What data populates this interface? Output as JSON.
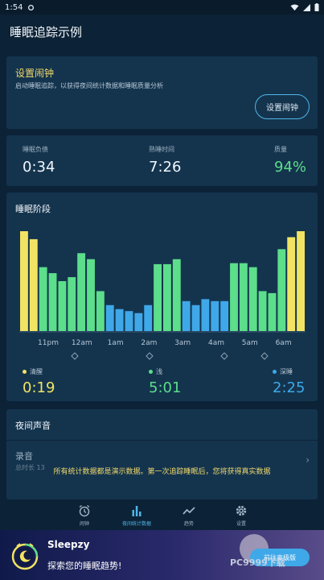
{
  "status_bar": {
    "time": "1:54"
  },
  "app_bar": {
    "title": "睡眠追踪示例"
  },
  "alarm_card": {
    "title": "设置闹钟",
    "description": "启动睡眠追踪，以获得夜间统计数据和睡眠质量分析",
    "button_label": "设置闹钟"
  },
  "stats": [
    {
      "label": "睡眠负债",
      "value": "0:34"
    },
    {
      "label": "熟睡时间",
      "value": "7:26"
    },
    {
      "label": "质量",
      "value": "94%"
    }
  ],
  "stages_card": {
    "title": "睡眠阶段"
  },
  "chart_data": {
    "type": "bar",
    "x_ticks": [
      "11pm",
      "12am",
      "1am",
      "2am",
      "3am",
      "4am",
      "5am",
      "6am"
    ],
    "values": [
      100,
      92,
      64,
      58,
      50,
      54,
      78,
      72,
      40,
      26,
      22,
      20,
      18,
      26,
      67,
      67,
      72,
      30,
      26,
      32,
      30,
      30,
      68,
      68,
      64,
      40,
      38,
      82,
      94,
      100
    ],
    "stages": [
      "awake",
      "awake",
      "light",
      "light",
      "light",
      "light",
      "light",
      "light",
      "light",
      "deep",
      "deep",
      "deep",
      "deep",
      "deep",
      "light",
      "light",
      "light",
      "deep",
      "deep",
      "deep",
      "deep",
      "deep",
      "light",
      "light",
      "light",
      "light",
      "light",
      "light",
      "awake",
      "awake"
    ],
    "ylim": [
      0,
      100
    ],
    "colors": {
      "awake": "#f2e462",
      "light": "#5cde8a",
      "deep": "#3fa8e8"
    }
  },
  "legend": [
    {
      "label": "清醒",
      "value": "0:19",
      "color": "#f2e462"
    },
    {
      "label": "浅",
      "value": "5:01",
      "color": "#5cde8a"
    },
    {
      "label": "深睡",
      "value": "2:25",
      "color": "#3fa8e8"
    }
  ],
  "sound_card": {
    "title": "夜间声音",
    "recording_label": "录音",
    "recording_sub": "总时长 13"
  },
  "notice": "所有统计数据都是演示数据。第一次追踪睡眠后，您将获得真实数据",
  "bottom_nav": [
    {
      "label": "闹钟",
      "icon": "alarm-clock-icon"
    },
    {
      "label": "夜间统计数据",
      "icon": "bar-chart-icon"
    },
    {
      "label": "趋势",
      "icon": "trend-icon"
    },
    {
      "label": "设置",
      "icon": "gear-icon"
    }
  ],
  "promo": {
    "title": "Sleepzy",
    "subtitle": "探索您的睡眠趋势!",
    "button_label": "前往高级版"
  },
  "watermark": "PC9999下载"
}
